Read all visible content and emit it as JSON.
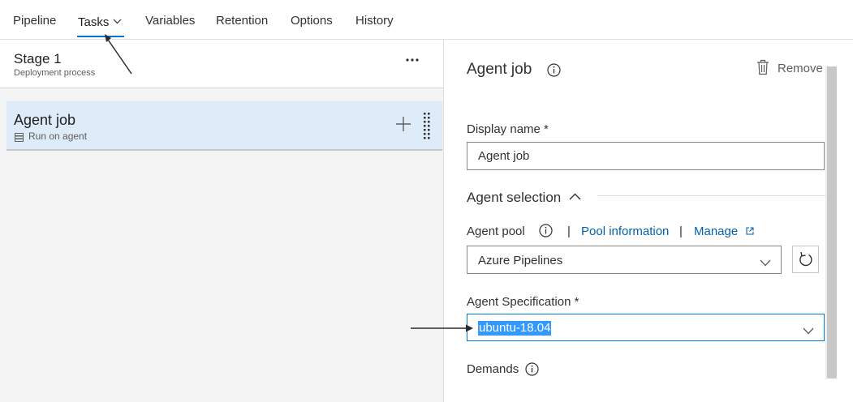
{
  "tabs": [
    {
      "label": "Pipeline"
    },
    {
      "label": "Tasks"
    },
    {
      "label": "Variables"
    },
    {
      "label": "Retention"
    },
    {
      "label": "Options"
    },
    {
      "label": "History"
    }
  ],
  "active_tab": "Tasks",
  "stage": {
    "title": "Stage 1",
    "subtitle": "Deployment process"
  },
  "job": {
    "title": "Agent job",
    "subtitle": "Run on agent"
  },
  "panel": {
    "title": "Agent job",
    "remove_label": "Remove",
    "display_name_label": "Display name *",
    "display_name_value": "Agent job",
    "agent_selection_title": "Agent selection",
    "agent_pool_label": "Agent pool",
    "pool_information_link": "Pool information",
    "manage_link": "Manage",
    "separator": "|",
    "agent_pool_value": "Azure Pipelines",
    "agent_spec_label": "Agent Specification *",
    "agent_spec_value": "ubuntu-18.04",
    "demands_label": "Demands"
  },
  "colors": {
    "accent": "#0078d4",
    "link": "#0062ad",
    "selected_row": "#deecf9",
    "text_selection": "#3399ff"
  }
}
